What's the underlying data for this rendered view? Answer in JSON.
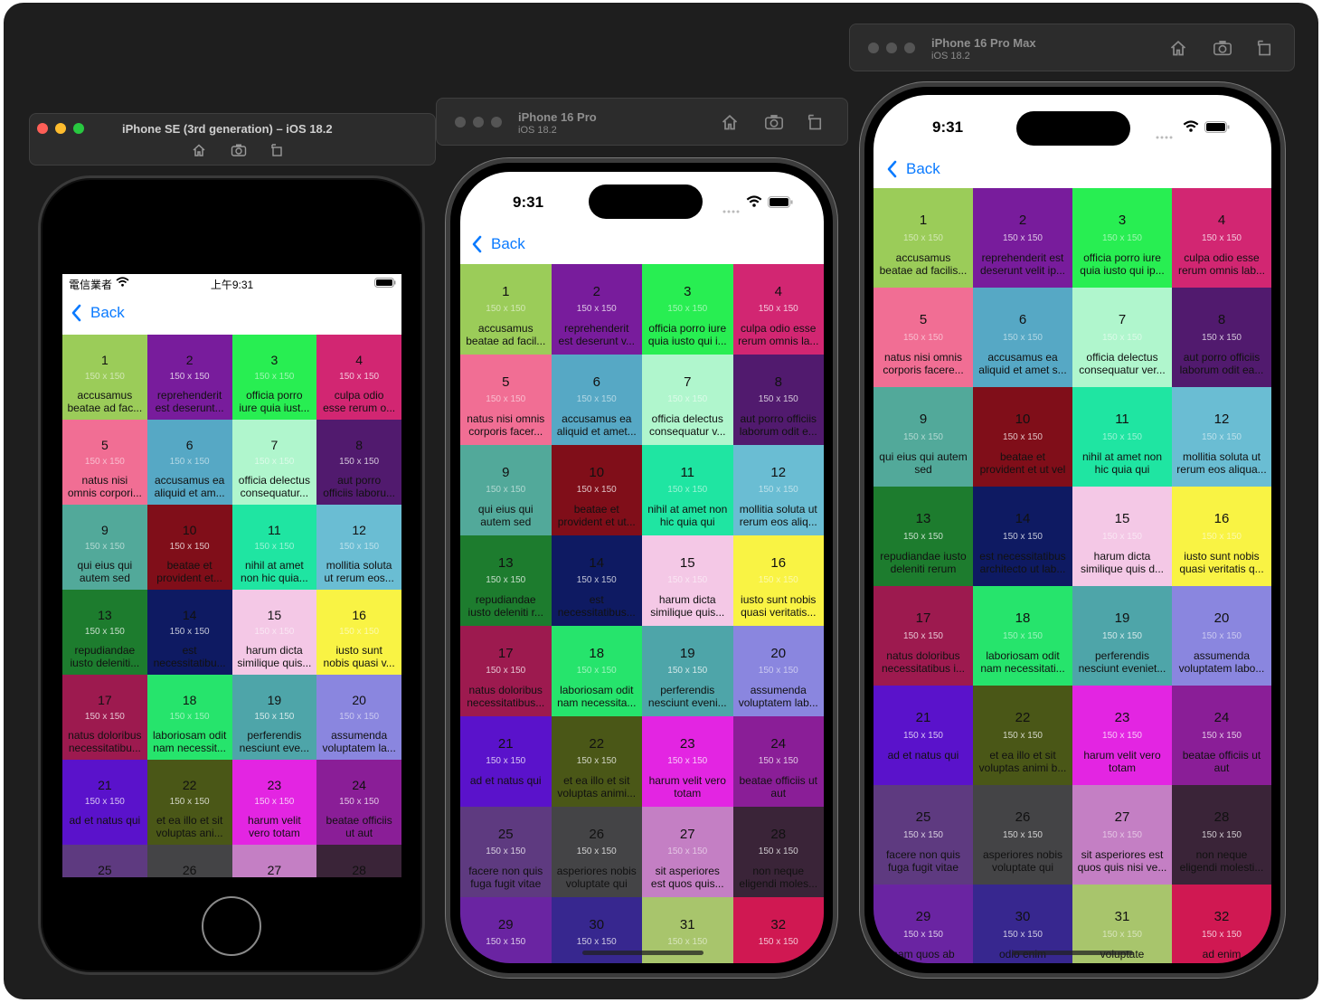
{
  "windows": [
    {
      "title": "iPhone SE (3rd generation) – iOS 18.2",
      "subtitle": ""
    },
    {
      "title": "iPhone 16 Pro",
      "subtitle": "iOS 18.2"
    },
    {
      "title": "iPhone 16 Pro Max",
      "subtitle": "iOS 18.2"
    }
  ],
  "toolbar_icons": [
    "home-icon",
    "screenshot-icon",
    "rotate-icon"
  ],
  "se_status": {
    "carrier": "電信業者",
    "time": "上午9:31"
  },
  "pro_status": {
    "time": "9:31"
  },
  "nav": {
    "back_label": "Back"
  },
  "photo_size_label": "150 x 150",
  "photos": [
    {
      "id": "1",
      "color": "#9bcc59",
      "l1": "accusamus",
      "l2": "beatae ad facilis..."
    },
    {
      "id": "2",
      "color": "#781c9c",
      "l1": "reprehenderit est",
      "l2": "deserunt velit ip..."
    },
    {
      "id": "3",
      "color": "#28ee52",
      "l1": "officia porro iure",
      "l2": "quia iusto qui ip..."
    },
    {
      "id": "4",
      "color": "#d22672",
      "l1": "culpa odio esse",
      "l2": "rerum omnis lab..."
    },
    {
      "id": "5",
      "color": "#f16e94",
      "l1": "natus nisi omnis",
      "l2": "corporis facere..."
    },
    {
      "id": "6",
      "color": "#56a8c5",
      "l1": "accusamus ea",
      "l2": "aliquid et amet s..."
    },
    {
      "id": "7",
      "color": "#b0f6cd",
      "l1": "officia delectus",
      "l2": "consequatur ver..."
    },
    {
      "id": "8",
      "color": "#511a6e",
      "l1": "aut porro officiis",
      "l2": "laborum odit ea..."
    },
    {
      "id": "9",
      "color": "#52a99a",
      "l1": "qui eius qui autem",
      "l2": "sed"
    },
    {
      "id": "10",
      "color": "#800e19",
      "l1": "beatae et",
      "l2": "provident et ut vel"
    },
    {
      "id": "11",
      "color": "#1fe5a2",
      "l1": "nihil at amet non",
      "l2": "hic quia qui"
    },
    {
      "id": "12",
      "color": "#6abdd3",
      "l1": "mollitia soluta ut",
      "l2": "rerum eos aliqua..."
    },
    {
      "id": "13",
      "color": "#1d7c2e",
      "l1": "repudiandae iusto",
      "l2": "deleniti rerum"
    },
    {
      "id": "14",
      "color": "#0e1a62",
      "l1": "est necessitatibus",
      "l2": "architecto ut lab..."
    },
    {
      "id": "15",
      "color": "#f4c8e6",
      "l1": "harum dicta",
      "l2": "similique quis d..."
    },
    {
      "id": "16",
      "color": "#f9f344",
      "l1": "iusto sunt nobis",
      "l2": "quasi veritatis q..."
    },
    {
      "id": "17",
      "color": "#9d1a4f",
      "l1": "natus doloribus",
      "l2": "necessitatibus i..."
    },
    {
      "id": "18",
      "color": "#26e46c",
      "l1": "laboriosam odit",
      "l2": "nam necessitati..."
    },
    {
      "id": "19",
      "color": "#4ea5a9",
      "l1": "perferendis",
      "l2": "nesciunt eveniet..."
    },
    {
      "id": "20",
      "color": "#8a86df",
      "l1": "assumenda",
      "l2": "voluptatem labo..."
    },
    {
      "id": "21",
      "color": "#5a12cb",
      "l1": "ad et natus qui",
      "l2": ""
    },
    {
      "id": "22",
      "color": "#4a5717",
      "l1": "et ea illo et sit",
      "l2": "voluptas animi b..."
    },
    {
      "id": "23",
      "color": "#e325e2",
      "l1": "harum velit vero",
      "l2": "totam"
    },
    {
      "id": "24",
      "color": "#8a1e97",
      "l1": "beatae officiis ut",
      "l2": "aut"
    },
    {
      "id": "25",
      "color": "#5e3a80",
      "l1": "facere non quis",
      "l2": "fuga fugit vitae"
    },
    {
      "id": "26",
      "color": "#444446",
      "l1": "asperiores nobis",
      "l2": "voluptate qui"
    },
    {
      "id": "27",
      "color": "#c47fc4",
      "l1": "sit asperiores est",
      "l2": "quos quis nisi ve..."
    },
    {
      "id": "28",
      "color": "#3a2438",
      "l1": "non neque",
      "l2": "eligendi molesti..."
    },
    {
      "id": "29",
      "color": "#6a24a2",
      "l1": "nam quos ab",
      "l2": ""
    },
    {
      "id": "30",
      "color": "#37278f",
      "l1": "odio enim",
      "l2": ""
    },
    {
      "id": "31",
      "color": "#a8c56c",
      "l1": "voluptate",
      "l2": ""
    },
    {
      "id": "32",
      "color": "#d01852",
      "l1": "ad enim",
      "l2": ""
    }
  ],
  "se_captions": [
    [
      "accusamus",
      "beatae ad fac..."
    ],
    [
      "reprehenderit",
      "est deserunt..."
    ],
    [
      "officia porro",
      "iure quia iust..."
    ],
    [
      "culpa odio",
      "esse rerum o..."
    ],
    [
      "natus nisi",
      "omnis corpori..."
    ],
    [
      "accusamus ea",
      "aliquid et am..."
    ],
    [
      "officia delectus",
      "consequatur..."
    ],
    [
      "aut porro",
      "officiis laboru..."
    ],
    [
      "qui eius qui",
      "autem sed"
    ],
    [
      "beatae et",
      "provident et..."
    ],
    [
      "nihil at amet",
      "non hic quia..."
    ],
    [
      "mollitia soluta",
      "ut rerum eos..."
    ],
    [
      "repudiandae",
      "iusto deleniti..."
    ],
    [
      "est",
      "necessitatibu..."
    ],
    [
      "harum dicta",
      "similique quis..."
    ],
    [
      "iusto sunt",
      "nobis quasi v..."
    ],
    [
      "natus doloribus",
      "necessitatibu..."
    ],
    [
      "laboriosam odit",
      "nam necessit..."
    ],
    [
      "perferendis",
      "nesciunt eve..."
    ],
    [
      "assumenda",
      "voluptatem la..."
    ],
    [
      "ad et natus qui",
      ""
    ],
    [
      "et ea illo et sit",
      "voluptas ani..."
    ],
    [
      "harum velit",
      "vero totam"
    ],
    [
      "beatae officiis",
      "ut aut"
    ],
    [
      "",
      ""
    ],
    [
      "",
      ""
    ],
    [
      "",
      ""
    ],
    [
      "",
      ""
    ]
  ],
  "pro_captions": [
    [
      "accusamus",
      "beatae ad facil..."
    ],
    [
      "reprehenderit",
      "est deserunt v..."
    ],
    [
      "officia porro iure",
      "quia iusto qui i..."
    ],
    [
      "culpa odio esse",
      "rerum omnis la..."
    ],
    [
      "natus nisi omnis",
      "corporis facer..."
    ],
    [
      "accusamus ea",
      "aliquid et amet..."
    ],
    [
      "officia delectus",
      "consequatur v..."
    ],
    [
      "aut porro officiis",
      "laborum odit e..."
    ],
    [
      "qui eius qui",
      "autem sed"
    ],
    [
      "beatae et",
      "provident et ut..."
    ],
    [
      "nihil at amet non",
      "hic quia qui"
    ],
    [
      "mollitia soluta ut",
      "rerum eos aliq..."
    ],
    [
      "repudiandae",
      "iusto deleniti r..."
    ],
    [
      "est",
      "necessitatibus..."
    ],
    [
      "harum dicta",
      "similique quis..."
    ],
    [
      "iusto sunt nobis",
      "quasi veritatis..."
    ],
    [
      "natus doloribus",
      "necessitatibus..."
    ],
    [
      "laboriosam odit",
      "nam necessita..."
    ],
    [
      "perferendis",
      "nesciunt eveni..."
    ],
    [
      "assumenda",
      "voluptatem lab..."
    ],
    [
      "ad et natus qui",
      ""
    ],
    [
      "et ea illo et sit",
      "voluptas animi..."
    ],
    [
      "harum velit vero",
      "totam"
    ],
    [
      "beatae officiis ut",
      "aut"
    ],
    [
      "facere non quis",
      "fuga fugit vitae"
    ],
    [
      "asperiores nobis",
      "voluptate qui"
    ],
    [
      "sit asperiores",
      "est quos quis..."
    ],
    [
      "non neque",
      "eligendi moles..."
    ],
    [
      "",
      ""
    ],
    [
      "",
      ""
    ],
    [
      "",
      ""
    ],
    [
      "",
      ""
    ]
  ],
  "max_captions": [
    [
      "accusamus",
      "beatae ad facilis..."
    ],
    [
      "reprehenderit est",
      "deserunt velit ip..."
    ],
    [
      "officia porro iure",
      "quia iusto qui ip..."
    ],
    [
      "culpa odio esse",
      "rerum omnis lab..."
    ],
    [
      "natus nisi omnis",
      "corporis facere..."
    ],
    [
      "accusamus ea",
      "aliquid et amet s..."
    ],
    [
      "officia delectus",
      "consequatur ver..."
    ],
    [
      "aut porro officiis",
      "laborum odit ea..."
    ],
    [
      "qui eius qui autem",
      "sed"
    ],
    [
      "beatae et",
      "provident et ut vel"
    ],
    [
      "nihil at amet non",
      "hic quia qui"
    ],
    [
      "mollitia soluta ut",
      "rerum eos aliqua..."
    ],
    [
      "repudiandae iusto",
      "deleniti rerum"
    ],
    [
      "est necessitatibus",
      "architecto ut lab..."
    ],
    [
      "harum dicta",
      "similique quis d..."
    ],
    [
      "iusto sunt nobis",
      "quasi veritatis q..."
    ],
    [
      "natus doloribus",
      "necessitatibus i..."
    ],
    [
      "laboriosam odit",
      "nam necessitati..."
    ],
    [
      "perferendis",
      "nesciunt eveniet..."
    ],
    [
      "assumenda",
      "voluptatem labo..."
    ],
    [
      "ad et natus qui",
      ""
    ],
    [
      "et ea illo et sit",
      "voluptas animi b..."
    ],
    [
      "harum velit vero",
      "totam"
    ],
    [
      "beatae officiis ut",
      "aut"
    ],
    [
      "facere non quis",
      "fuga fugit vitae"
    ],
    [
      "asperiores nobis",
      "voluptate qui"
    ],
    [
      "sit asperiores est",
      "quos quis nisi ve..."
    ],
    [
      "non neque",
      "eligendi molesti..."
    ],
    [
      "nam quos ab",
      ""
    ],
    [
      "odio enim",
      ""
    ],
    [
      "voluptate",
      ""
    ],
    [
      "ad enim",
      ""
    ]
  ]
}
